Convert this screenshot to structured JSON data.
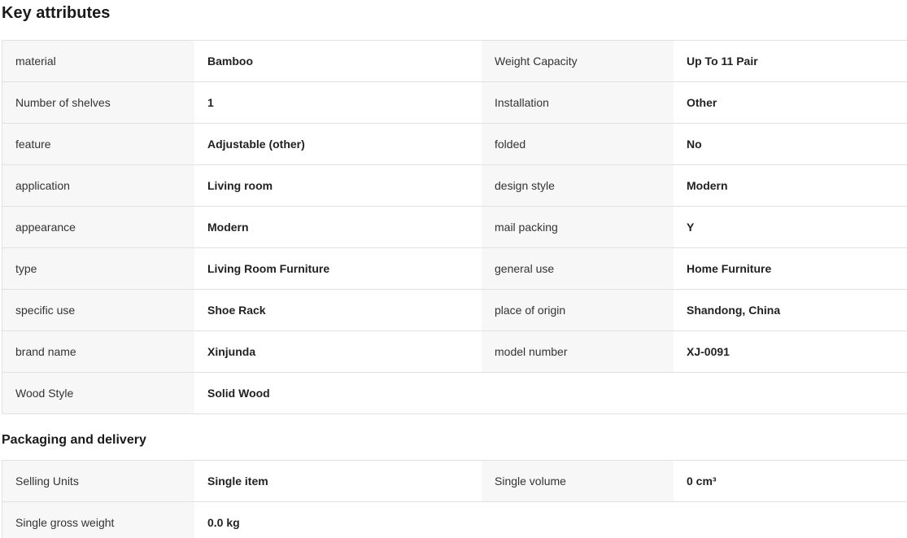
{
  "key_attributes": {
    "title": "Key attributes",
    "rows": [
      {
        "l1": "material",
        "v1": "Bamboo",
        "l2": "Weight Capacity",
        "v2": "Up To 11 Pair"
      },
      {
        "l1": "Number of shelves",
        "v1": "1",
        "l2": "Installation",
        "v2": "Other"
      },
      {
        "l1": "feature",
        "v1": "Adjustable (other)",
        "l2": "folded",
        "v2": "No"
      },
      {
        "l1": "application",
        "v1": "Living room",
        "l2": "design style",
        "v2": "Modern"
      },
      {
        "l1": "appearance",
        "v1": "Modern",
        "l2": "mail packing",
        "v2": "Y"
      },
      {
        "l1": "type",
        "v1": "Living Room Furniture",
        "l2": "general use",
        "v2": "Home Furniture"
      },
      {
        "l1": "specific use",
        "v1": "Shoe Rack",
        "l2": "place of origin",
        "v2": "Shandong, China"
      },
      {
        "l1": "brand name",
        "v1": "Xinjunda",
        "l2": "model number",
        "v2": "XJ-0091"
      },
      {
        "l1": "Wood Style",
        "v1": "Solid Wood"
      }
    ]
  },
  "packaging": {
    "title": "Packaging and delivery",
    "rows": [
      {
        "l1": "Selling Units",
        "v1": "Single item",
        "l2": "Single volume",
        "v2": "0 cm³"
      },
      {
        "l1": "Single gross weight",
        "v1": "0.0 kg"
      }
    ]
  }
}
